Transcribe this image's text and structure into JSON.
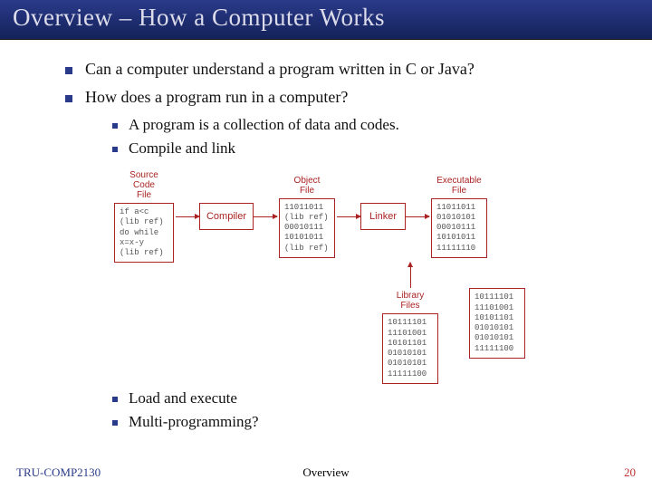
{
  "title": "Overview – How a Computer Works",
  "bullets": [
    "Can a computer understand a program written in C or Java?",
    "How does a program run in a computer?"
  ],
  "sub_a": [
    "A program is a collection of data and codes.",
    "Compile and link"
  ],
  "sub_b": [
    "Load and execute",
    "Multi-programming?"
  ],
  "diagram": {
    "labels": {
      "source": "Source\nCode\nFile",
      "object": "Object\nFile",
      "exec": "Executable\nFile",
      "compiler": "Compiler",
      "linker": "Linker",
      "library": "Library\nFiles"
    },
    "source_code": "if a<c\n(lib ref)\ndo while\nx=x-y\n(lib ref)",
    "object_code": "11011011\n(lib ref)\n00010111\n10101011\n(lib ref)",
    "exec_code": "11011011\n01010101\n00010111\n10101011\n11111110",
    "lib1": "10111101\n11101001\n10101101\n01010101\n01010101\n11111100",
    "lib2": "10111101\n11101001\n10101101\n01010101\n01010101\n11111100"
  },
  "footer": {
    "left": "TRU-COMP2130",
    "center": "Overview",
    "right": "20"
  }
}
